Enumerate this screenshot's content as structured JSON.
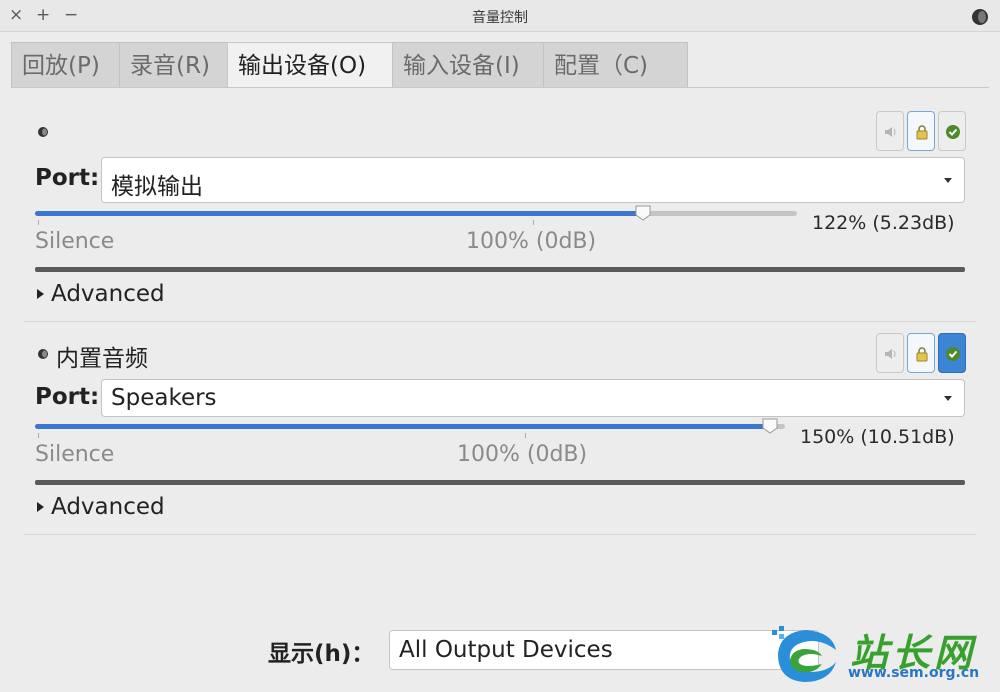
{
  "window": {
    "title": "音量控制",
    "close_icon": "×",
    "maximize_icon": "+",
    "minimize_icon": "−"
  },
  "tabs": [
    {
      "label": "回放(P)",
      "active": false
    },
    {
      "label": "录音(R)",
      "active": false
    },
    {
      "label": "输出设备(O)",
      "active": true
    },
    {
      "label": "输入设备(I)",
      "active": false
    },
    {
      "label": "配置（C)",
      "active": false
    }
  ],
  "devices": [
    {
      "name": "",
      "port_label": "Port:",
      "port_value": "模拟输出",
      "volume_text": "122% (5.23dB)",
      "volume_percent": 122,
      "mark_silence": "Silence",
      "mark_100": "100% (0dB)",
      "advanced_label": "Advanced",
      "mute_icon": "speaker-icon",
      "lock_icon": "lock-icon",
      "default_icon": "check-icon",
      "default_active": false
    },
    {
      "name": "内置音频",
      "port_label": "Port:",
      "port_value": "Speakers",
      "volume_text": "150% (10.51dB)",
      "volume_percent": 150,
      "mark_silence": "Silence",
      "mark_100": "100% (0dB)",
      "advanced_label": "Advanced",
      "mute_icon": "speaker-icon",
      "lock_icon": "lock-icon",
      "default_icon": "check-icon",
      "default_active": true
    }
  ],
  "footer": {
    "show_label": "显示(h)：",
    "show_value": "All Output Devices"
  },
  "watermark": {
    "text": "站长网",
    "url": "www.sem.org.cn"
  },
  "colors": {
    "accent": "#3a78cf",
    "watermark_green": "#38a12e",
    "watermark_blue": "#2a76c4"
  }
}
